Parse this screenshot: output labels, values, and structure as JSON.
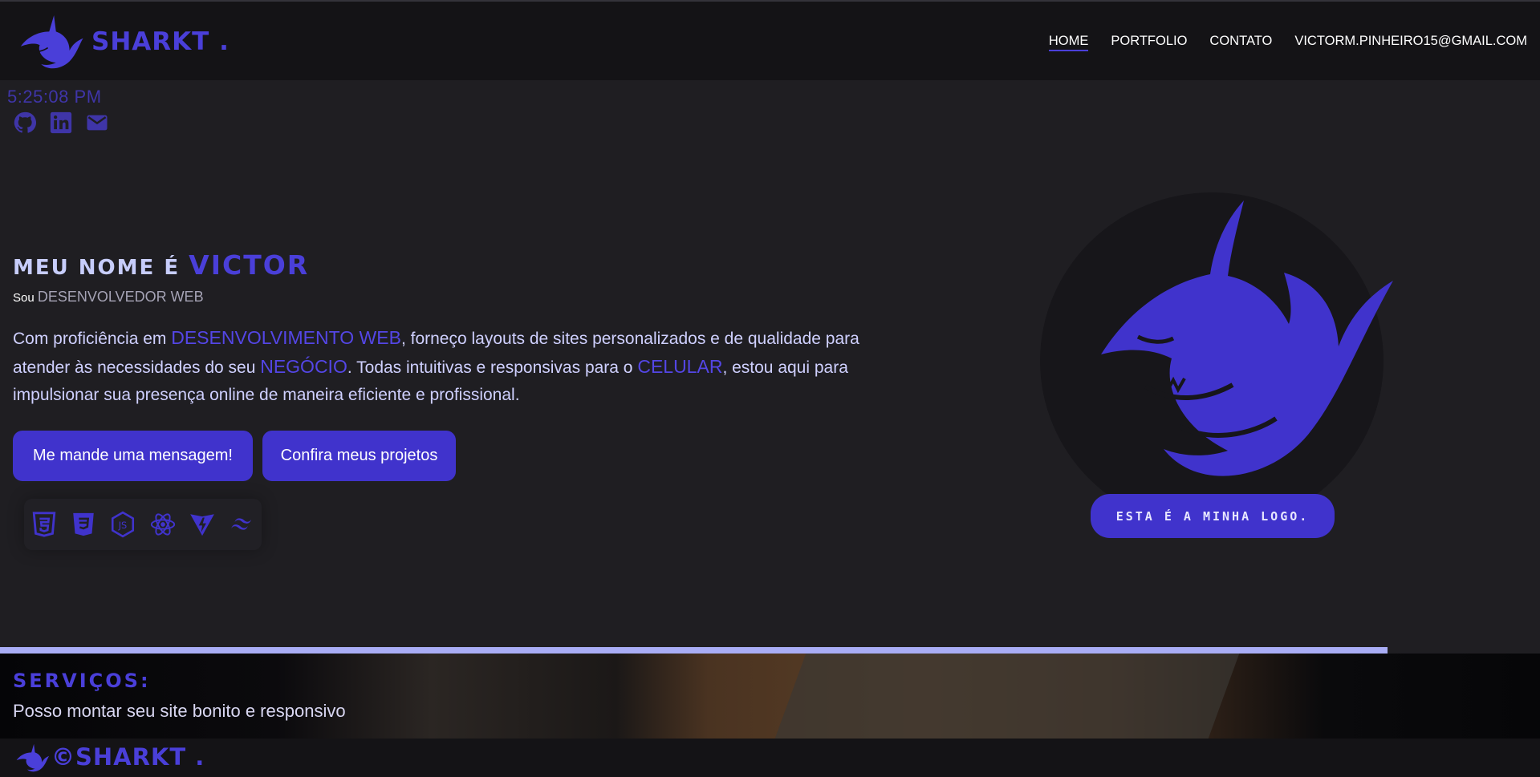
{
  "header": {
    "brand": "SHARKT .",
    "nav": [
      "HOME",
      "PORTFOLIO",
      "CONTATO",
      "VICTORM.PINHEIRO15@GMAIL.COM"
    ]
  },
  "clock": "5:25:08 PM",
  "socials": [
    "github-icon",
    "linkedin-icon",
    "mail-icon"
  ],
  "hero": {
    "title_prefix": "MEU NOME É ",
    "title_name": "VICTOR",
    "sub_prefix": "Sou ",
    "sub_role": "DESENVOLVEDOR WEB",
    "desc_1": "Com proficiência em ",
    "desc_hl1": "DESENVOLVIMENTO WEB",
    "desc_2": ", forneço layouts de sites personalizados e de qualidade para atender às necessidades do seu ",
    "desc_hl2": "NEGÓCIO",
    "desc_3": ". Todas intuitivas e responsivas para o ",
    "desc_hl3": "CELULAR",
    "desc_4": ", estou aqui para impulsionar sua presença online de maneira eficiente e profissional.",
    "btn_message": "Me mande uma mensagem!",
    "btn_projects": "Confira meus projetos"
  },
  "tech_icons": [
    "html5-icon",
    "css3-icon",
    "nodejs-icon",
    "react-icon",
    "vite-icon",
    "tailwind-icon"
  ],
  "logo_badge": "ESTA É A MINHA LOGO.",
  "services": {
    "title": "SERVIÇOS:",
    "text": "Posso montar seu site bonito e responsivo"
  },
  "footer": {
    "text": "©SHARKT ."
  },
  "colors": {
    "accent": "#4a3fd9",
    "button": "#4033cc",
    "background": "#1f1e22",
    "header": "#141316",
    "divider": "#a9adf5"
  }
}
